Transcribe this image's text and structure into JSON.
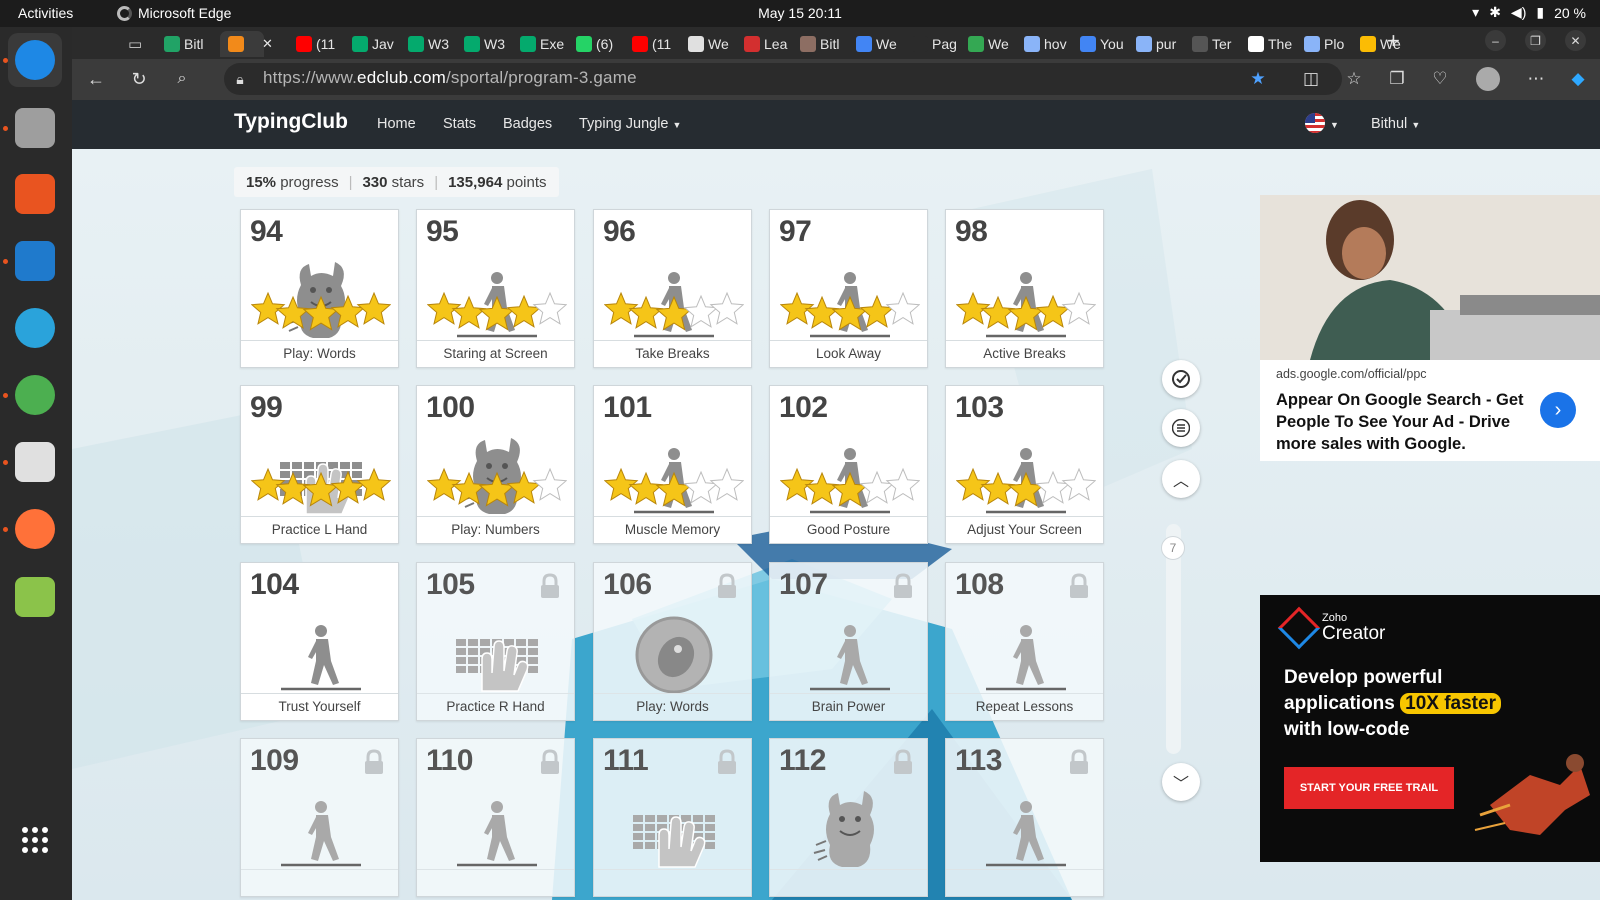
{
  "system": {
    "activities": "Activities",
    "app_name": "Microsoft Edge",
    "clock": "May 15  20:11",
    "battery": "20 %"
  },
  "dock": [
    {
      "name": "edge",
      "color": "#1e88e5"
    },
    {
      "name": "files",
      "color": "#9e9e9e"
    },
    {
      "name": "app-center",
      "color": "#e95420"
    },
    {
      "name": "vscode",
      "color": "#1f7acc"
    },
    {
      "name": "telegram",
      "color": "#2aa3db"
    },
    {
      "name": "chrome",
      "color": "#4caf50"
    },
    {
      "name": "text-editor",
      "color": "#e0e0e0"
    },
    {
      "name": "firefox",
      "color": "#ff7139"
    },
    {
      "name": "trash",
      "color": "#8bc34a"
    }
  ],
  "tabs": [
    {
      "label": "Bitl",
      "color": "#21a366"
    },
    {
      "label": "",
      "color": "#f28a1a",
      "active": true
    },
    {
      "label": "(11",
      "color": "#ff0000"
    },
    {
      "label": "Jav",
      "color": "#04aa6d"
    },
    {
      "label": "W3",
      "color": "#04aa6d"
    },
    {
      "label": "W3",
      "color": "#04aa6d"
    },
    {
      "label": "Exe",
      "color": "#04aa6d"
    },
    {
      "label": "(6)",
      "color": "#25d366"
    },
    {
      "label": "(11",
      "color": "#ff0000"
    },
    {
      "label": "We",
      "color": "#e0e0e0"
    },
    {
      "label": "Lea",
      "color": "#d32f2f"
    },
    {
      "label": "Bitl",
      "color": "#8d6e63"
    },
    {
      "label": "We",
      "color": "#4285f4"
    },
    {
      "label": "Pag",
      "color": "#2b2b2b"
    },
    {
      "label": "We",
      "color": "#34a853"
    },
    {
      "label": "hov",
      "color": "#8ab4f8"
    },
    {
      "label": "You",
      "color": "#4285f4"
    },
    {
      "label": "pur",
      "color": "#8ab4f8"
    },
    {
      "label": "Ter",
      "color": "#555555"
    },
    {
      "label": "The",
      "color": "#ffffff"
    },
    {
      "label": "Plo",
      "color": "#8ab4f8"
    },
    {
      "label": "We",
      "color": "#fbbc04"
    }
  ],
  "address": {
    "prefix": "https://www.",
    "host": "edclub.com",
    "path": "/sportal/program-3.game"
  },
  "nav": {
    "brand": "TypingClub",
    "links": [
      "Home",
      "Stats",
      "Badges",
      "Typing Jungle"
    ],
    "user": "Bithul"
  },
  "stats": {
    "progress_value": "15%",
    "progress_label": "progress",
    "stars_value": "330",
    "stars_label": "stars",
    "points_value": "135,964",
    "points_label": "points"
  },
  "lessons": [
    {
      "num": "94",
      "title": "Play: Words",
      "icon": "monster-icon",
      "stars": 5,
      "locked": false
    },
    {
      "num": "95",
      "title": "Staring at Screen",
      "icon": "walking-person-icon",
      "stars": 4,
      "locked": false
    },
    {
      "num": "96",
      "title": "Take Breaks",
      "icon": "walking-person-icon",
      "stars": 3,
      "locked": false
    },
    {
      "num": "97",
      "title": "Look Away",
      "icon": "walking-person-icon",
      "stars": 4,
      "locked": false
    },
    {
      "num": "98",
      "title": "Active Breaks",
      "icon": "walking-person-icon",
      "stars": 4,
      "locked": false
    },
    {
      "num": "99",
      "title": "Practice L Hand",
      "icon": "keyboard-hand-icon",
      "stars": 5,
      "locked": false
    },
    {
      "num": "100",
      "title": "Play: Numbers",
      "icon": "monster-icon",
      "stars": 4,
      "locked": false
    },
    {
      "num": "101",
      "title": "Muscle Memory",
      "icon": "walking-person-icon",
      "stars": 3,
      "locked": false
    },
    {
      "num": "102",
      "title": "Good Posture",
      "icon": "walking-person-icon",
      "stars": 3,
      "locked": false
    },
    {
      "num": "103",
      "title": "Adjust Your Screen",
      "icon": "walking-person-icon",
      "stars": 3,
      "locked": false
    },
    {
      "num": "104",
      "title": "Trust Yourself",
      "icon": "walking-person-icon",
      "stars": 0,
      "locked": false
    },
    {
      "num": "105",
      "title": "Practice R Hand",
      "icon": "keyboard-hand-icon",
      "stars": 0,
      "locked": true
    },
    {
      "num": "106",
      "title": "Play: Words",
      "icon": "game-badge-icon",
      "stars": 0,
      "locked": true
    },
    {
      "num": "107",
      "title": "Brain Power",
      "icon": "walking-person-icon",
      "stars": 0,
      "locked": true
    },
    {
      "num": "108",
      "title": "Repeat Lessons",
      "icon": "walking-person-icon",
      "stars": 0,
      "locked": true
    },
    {
      "num": "109",
      "title": "",
      "icon": "walking-person-icon",
      "stars": 0,
      "locked": true
    },
    {
      "num": "110",
      "title": "",
      "icon": "walking-person-icon",
      "stars": 0,
      "locked": true
    },
    {
      "num": "111",
      "title": "",
      "icon": "keyboard-hand-icon",
      "stars": 0,
      "locked": true
    },
    {
      "num": "112",
      "title": "",
      "icon": "monster-icon",
      "stars": 0,
      "locked": true
    },
    {
      "num": "113",
      "title": "",
      "icon": "walking-person-icon",
      "stars": 0,
      "locked": true
    }
  ],
  "side": {
    "page_indicator": "7"
  },
  "ad_google": {
    "domain": "ads.google.com/official/ppc",
    "headline": "Appear On Google Search - Get People To See Your Ad - Drive more sales with Google."
  },
  "ad_zoho": {
    "brand_small": "Zoho",
    "brand_big": "Creator",
    "line1": "Develop powerful",
    "line2": "applications",
    "highlight": "10X faster",
    "line3": "with low-code",
    "cta": "START YOUR FREE TRAIL"
  },
  "colors": {
    "star": "#f5c518",
    "star_empty": "#ffffff",
    "accent": "#1a73e8"
  }
}
